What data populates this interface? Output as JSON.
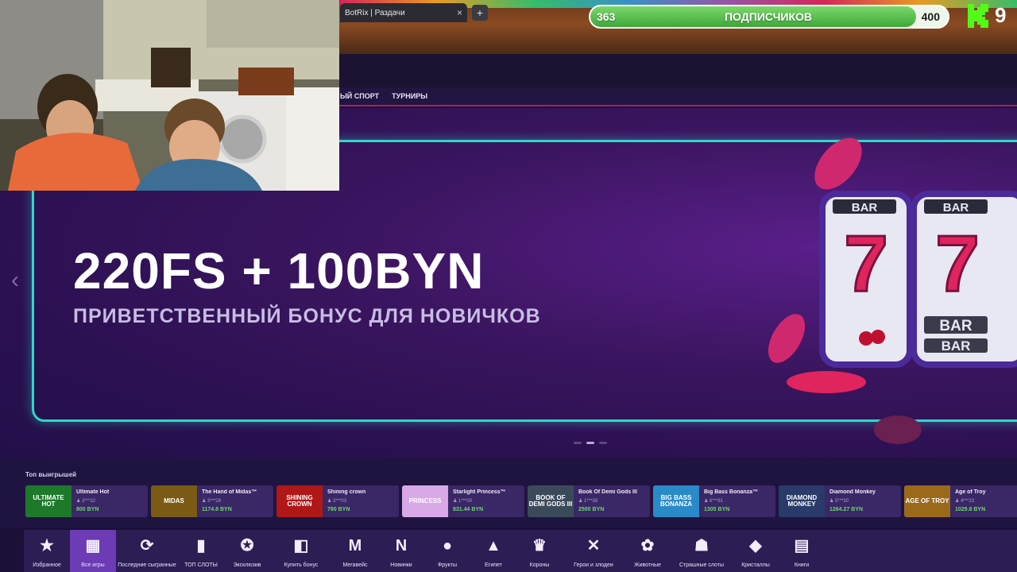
{
  "browser": {
    "tab_title": "BotRix | Раздачи",
    "tab_close": "×",
    "new_tab": "+"
  },
  "stream": {
    "subscribers_current": "363",
    "subscribers_label": "ПОДПИСЧИКОВ",
    "subscribers_goal": "400",
    "subscribers_progress": 0.91,
    "viewer_count": "9",
    "accent_green": "#53fc18"
  },
  "site": {
    "nav": [
      "ЫЙ СПОРТ",
      "ТУРНИРЫ"
    ],
    "accent": "#e0245e",
    "header_gift_icon": "gift-icon"
  },
  "banner": {
    "headline": "220FS + 100BYN",
    "subtitle": "ПРИВЕТСТВЕННЫЙ БОНУС ДЛЯ НОВИЧКОВ",
    "prev_arrow": "‹",
    "reel_labels": [
      "BAR",
      "BAR",
      "BAR",
      "BAR"
    ],
    "reel_symbols": [
      "7",
      "7"
    ],
    "slide_count": 3,
    "active_slide": 2
  },
  "top_wins": {
    "title": "Топ выигрышей",
    "items": [
      {
        "game": "Ultimate Hot",
        "user": "3***32",
        "amount": "800 BYN",
        "thumb": "ULTIMATE HOT",
        "color": "#1e7a2a"
      },
      {
        "game": "The Hand of Midas™",
        "user": "3***28",
        "amount": "1174.8 BYN",
        "thumb": "MIDAS",
        "color": "#7a5a14"
      },
      {
        "game": "Shining crown",
        "user": "3***03",
        "amount": "780 BYN",
        "thumb": "SHINING CROWN",
        "color": "#b01818"
      },
      {
        "game": "Starlight Princess™",
        "user": "1***00",
        "amount": "831.44 BYN",
        "thumb": "PRINCESS",
        "color": "#d8a8e8"
      },
      {
        "game": "Book Of Demi Gods III",
        "user": "1***38",
        "amount": "2500 BYN",
        "thumb": "BOOK OF DEMI GODS III",
        "color": "#3b4a5a"
      },
      {
        "game": "Big Bass Bonanza™",
        "user": "6***81",
        "amount": "1305 BYN",
        "thumb": "BIG BASS BONANZA",
        "color": "#2a8ac8"
      },
      {
        "game": "Diamond Monkey",
        "user": "5***30",
        "amount": "1264.27 BYN",
        "thumb": "DIAMOND MONKEY",
        "color": "#2a3a6a"
      },
      {
        "game": "Age of Troy",
        "user": "4***23",
        "amount": "1029.8 BYN",
        "thumb": "AGE OF TROY",
        "color": "#9a6a1a"
      }
    ]
  },
  "bottom_nav": {
    "items": [
      {
        "label": "Избранное",
        "icon": "★",
        "icon_name": "star-icon"
      },
      {
        "label": "Все игры",
        "icon": "▦",
        "icon_name": "grid-icon"
      },
      {
        "label": "Последние сыгранные",
        "icon": "⟳",
        "icon_name": "refresh-icon"
      },
      {
        "label": "ТОП СЛОТЫ",
        "icon": "▮",
        "icon_name": "bar-chart-icon"
      },
      {
        "label": "Эксклюзив",
        "icon": "✪",
        "icon_name": "exclusive-star-icon"
      },
      {
        "label": "Купить бонус",
        "icon": "◧",
        "icon_name": "buy-bonus-icon"
      },
      {
        "label": "Мегавейс",
        "icon": "M",
        "icon_name": "megaways-icon"
      },
      {
        "label": "Новинки",
        "icon": "N",
        "icon_name": "new-icon"
      },
      {
        "label": "Фрукты",
        "icon": "●",
        "icon_name": "apple-icon"
      },
      {
        "label": "Египет",
        "icon": "▲",
        "icon_name": "pyramid-icon"
      },
      {
        "label": "Короны",
        "icon": "♛",
        "icon_name": "crown-icon"
      },
      {
        "label": "Герои и злодеи",
        "icon": "✕",
        "icon_name": "swords-icon"
      },
      {
        "label": "Животные",
        "icon": "✿",
        "icon_name": "paw-icon"
      },
      {
        "label": "Страшные слоты",
        "icon": "☗",
        "icon_name": "ghost-icon"
      },
      {
        "label": "Кристаллы",
        "icon": "◆",
        "icon_name": "diamond-icon"
      },
      {
        "label": "Книги",
        "icon": "▤",
        "icon_name": "book-icon"
      }
    ],
    "active_index": 1
  }
}
